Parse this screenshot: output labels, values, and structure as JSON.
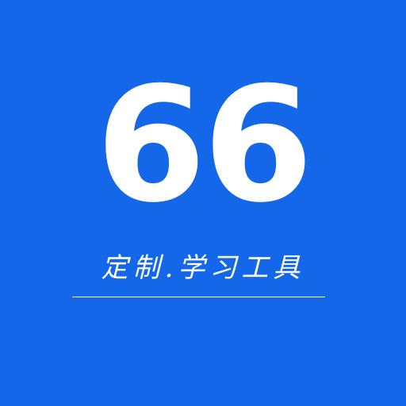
{
  "icon": {
    "number": "66",
    "tagline": "定制.学习工具",
    "background_color": "#1367e8",
    "text_color": "#ffffff"
  }
}
